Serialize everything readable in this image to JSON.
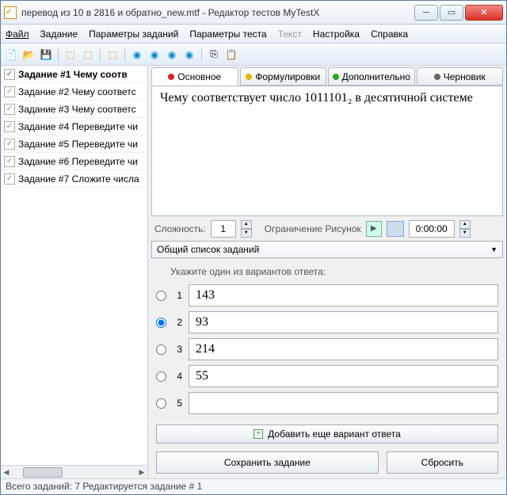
{
  "window": {
    "title": "перевод из 10 в 2816 и обратно_new.mtf - Редактор тестов MyTestX"
  },
  "menu": {
    "file": "Файл",
    "task": "Задание",
    "task_params": "Параметры заданий",
    "test_params": "Параметры теста",
    "text": "Текст",
    "settings": "Настройка",
    "help": "Справка"
  },
  "tasks": [
    "Задание #1 Чему соотв",
    "Задание #2 Чему соответс",
    "Задание #3 Чему соответс",
    "Задание #4 Переведите чи",
    "Задание #5 Переведите чи",
    "Задание #6 Переведите чи",
    "Задание #7 Сложите числа"
  ],
  "tabs": {
    "main": "Основное",
    "formulations": "Формулировки",
    "additional": "Дополнительно",
    "draft": "Черновик",
    "colors": {
      "main": "#d22",
      "formulations": "#e6b800",
      "additional": "#2a2",
      "draft": "#666"
    }
  },
  "question_text": "Чему соответствует число 1011101₂ в десятичной системе",
  "params": {
    "difficulty_label": "Сложность:",
    "difficulty": "1",
    "limit_label": "Ограничение Рисунок",
    "time": "0:00:00"
  },
  "dropdown": "Общий список заданий",
  "prompt": "Укажите один из вариантов ответа:",
  "options": [
    {
      "n": "1",
      "val": "143",
      "selected": false
    },
    {
      "n": "2",
      "val": "93",
      "selected": true
    },
    {
      "n": "3",
      "val": "214",
      "selected": false
    },
    {
      "n": "4",
      "val": "55",
      "selected": false
    },
    {
      "n": "5",
      "val": "",
      "selected": false
    }
  ],
  "buttons": {
    "add": "Добавить еще вариант ответа",
    "save": "Сохранить задание",
    "reset": "Сбросить"
  },
  "status": "Всего заданий: 7 Редактируется задание # 1"
}
